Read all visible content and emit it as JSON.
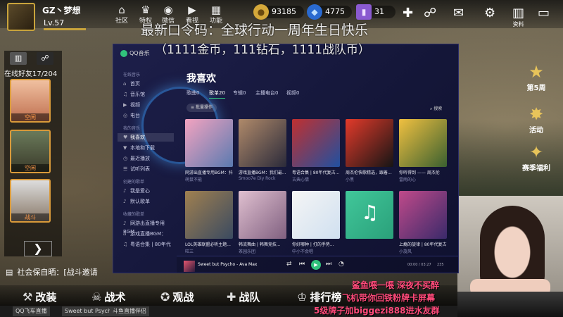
{
  "user": {
    "name": "GZ丶梦想",
    "level": "Lv.57"
  },
  "top_icons": [
    {
      "icon": "home-icon",
      "glyph": "⌂",
      "label": "社区"
    },
    {
      "icon": "crown-icon",
      "glyph": "♛",
      "label": "特权"
    },
    {
      "icon": "wechat-icon",
      "glyph": "◉",
      "label": "微信"
    },
    {
      "icon": "play-icon",
      "glyph": "▶",
      "label": "看视"
    },
    {
      "icon": "grid-icon",
      "glyph": "▦",
      "label": "功能"
    }
  ],
  "currencies": {
    "gold": "93185",
    "diamond": "4775",
    "ticket": "31"
  },
  "right_top_icons": [
    {
      "icon": "plus-icon",
      "glyph": "✚"
    },
    {
      "icon": "friends-icon",
      "glyph": "☍"
    },
    {
      "icon": "mail-icon",
      "glyph": "✉"
    },
    {
      "icon": "gear-icon",
      "glyph": "⚙"
    },
    {
      "icon": "book-icon",
      "glyph": "▥",
      "label": "资料"
    },
    {
      "icon": "battery-icon",
      "glyph": "▭"
    }
  ],
  "friends_panel": {
    "online_label": "在线好友17/204",
    "friend_tag": "空闲",
    "friend3_tag": "战斗"
  },
  "chat": {
    "label": "社会保自晒：[战斗邀请"
  },
  "bottom_nav": [
    {
      "icon": "wrench-icon",
      "glyph": "⚒",
      "label": "改装"
    },
    {
      "icon": "skull-icon",
      "glyph": "☠",
      "label": "战术"
    },
    {
      "icon": "star-icon",
      "glyph": "✪",
      "label": "观战"
    },
    {
      "icon": "team-icon",
      "glyph": "✚",
      "label": "战队"
    },
    {
      "icon": "trophy-icon",
      "glyph": "♔",
      "label": "排行榜"
    }
  ],
  "right_icons": [
    {
      "icon": "rank-star-icon",
      "glyph": "★",
      "label": "第5周"
    },
    {
      "icon": "event-icon",
      "glyph": "✸",
      "label": "活动"
    },
    {
      "icon": "season-icon",
      "glyph": "✦",
      "label": "赛季福利"
    }
  ],
  "overlay": {
    "line1": "最新口令码：全球行动一周年生日快乐",
    "line2": "（1111金币，111钻石，1111战队币）",
    "r1": "鲨鱼喂一喂 深夜不买醉",
    "r2": "飞机带你回铁粉牌卡屏幕",
    "r3": "5级牌子加biggezi888进水友群"
  },
  "taskbar": [
    "QQ飞车直播",
    "Sweet but Psycho",
    "斗鱼直播伴侣"
  ],
  "qq": {
    "app_title": "QQ音乐",
    "sidebar": {
      "online_music": "在线音乐",
      "items": [
        "首页",
        "音乐馆",
        "视频",
        "电台"
      ],
      "my_music": "我的音乐",
      "my_items": [
        "我喜欢",
        "本地和下载",
        "最近播放",
        "试听列表"
      ],
      "created": "创建的歌单",
      "created_items": [
        "我是爱心",
        "默认歌单"
      ],
      "collected": "收藏的歌单",
      "collected_items": [
        "网游出直播专用BGM",
        "游戏直播BGM：",
        "粤语合集 | 80年代"
      ]
    },
    "heading": "我喜欢",
    "tabs": [
      "歌曲0",
      "歌单20",
      "专辑0",
      "主播电台0",
      "视频0"
    ],
    "batch_label": "批量操作",
    "search_label": "搜索",
    "playlists": [
      {
        "title": "网游出直播专用BGM：抖...",
        "sub": "萌鼠不能",
        "c1": "#f3a3c0",
        "c2": "#5a7ab0"
      },
      {
        "title": "游戏直播BGM：我们最...",
        "sub": "Smoo7e Diy Rock",
        "c1": "#b08a6a",
        "c2": "#2a2a3a"
      },
      {
        "title": "粤语合集 | 80年代复古...",
        "sub": "古典心情",
        "c1": "#c03030",
        "c2": "#2050a0"
      },
      {
        "title": "周杰伦快歌精选，跟着...",
        "sub": "小黑",
        "c1": "#e33a2a",
        "c2": "#151515"
      },
      {
        "title": "你听得到 —— 周杰伦",
        "sub": "雷雨的心",
        "c1": "#f0c040",
        "c2": "#3a6030"
      },
      {
        "title": "LOL英雄联盟必听主题...",
        "sub": "旺三",
        "c1": "#a08050",
        "c2": "#3a4a60"
      },
      {
        "title": "韩流舞曲 | 韩舞竞技...",
        "sub": "茶园乐团",
        "c1": "#e0c0d0",
        "c2": "#806080"
      },
      {
        "title": "你好哪种 | 打的手势...",
        "sub": "中小不会唱",
        "c1": "#f5f5f5",
        "c2": "#d0e0f0"
      },
      {
        "title": "",
        "sub": "",
        "c1": "#41c79a",
        "c2": "#2aa07a"
      },
      {
        "title": "上瘾的旋律 | 80年代复古...",
        "sub": "小旋风",
        "c1": "#c04a8a",
        "c2": "#3a2a6a"
      }
    ],
    "player": {
      "title": "Sweet but Psycho - Ava Max",
      "time": "00:00 / 03:27",
      "count": "235"
    }
  }
}
